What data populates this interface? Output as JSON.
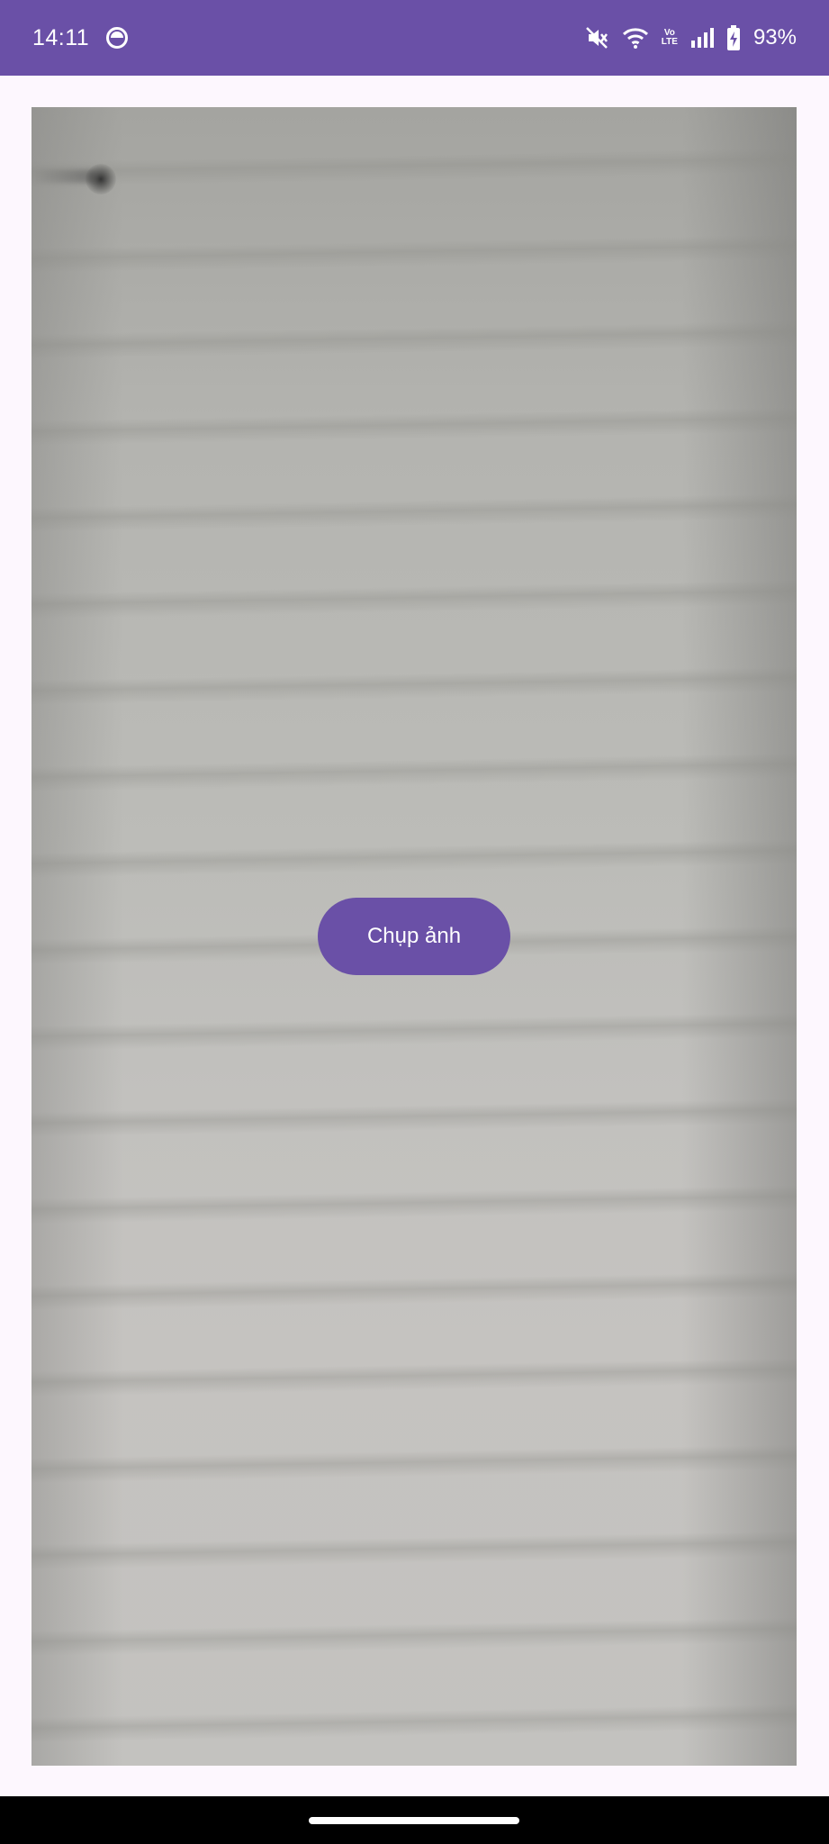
{
  "status_bar": {
    "time": "14:11",
    "battery_percent": "93%",
    "volte": {
      "top": "Vo",
      "bottom": "LTE"
    },
    "icons": [
      "sync-icon",
      "mute-icon",
      "wifi-icon",
      "volte-icon",
      "signal-icon",
      "battery-charging-icon"
    ],
    "background_color": "#6a50a7"
  },
  "camera_preview": {
    "name": "camera-preview"
  },
  "capture_button": {
    "label": "Chụp ảnh",
    "color": "#6a50a7",
    "text_color": "#ffffff"
  },
  "colors": {
    "page_background": "#fdf7fe",
    "nav_bar": "#000000"
  }
}
